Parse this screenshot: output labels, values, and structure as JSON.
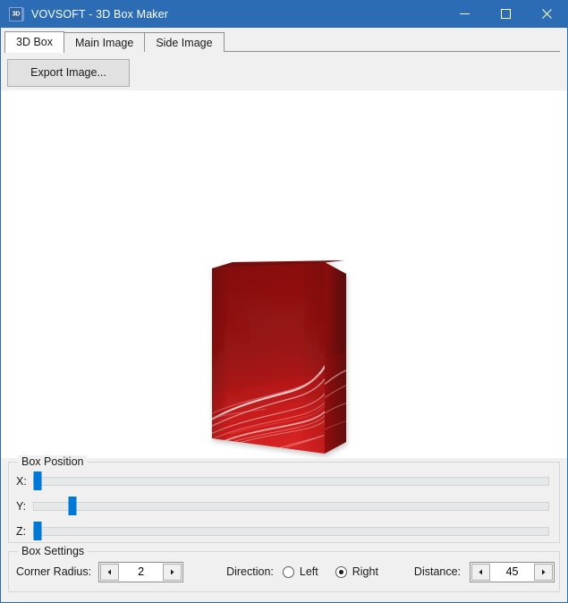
{
  "window": {
    "title": "VOVSOFT - 3D Box Maker",
    "icon_label": "3D",
    "icon_name": "app-icon-3d-box",
    "accent_color": "#2b6cb5",
    "controls": {
      "minimize": "minimize-icon",
      "maximize": "maximize-icon",
      "close": "close-icon"
    }
  },
  "tabs": [
    {
      "label": "3D Box",
      "active": true
    },
    {
      "label": "Main Image",
      "active": false
    },
    {
      "label": "Side Image",
      "active": false
    }
  ],
  "toolbar": {
    "export_label": "Export Image..."
  },
  "preview": {
    "description": "3D software box render",
    "front_color_top": "#8d1111",
    "front_color_bottom": "#d42020",
    "side_color": "#6d0f0f",
    "top_color": "#7c1010",
    "accent_swirl_color": "#ffffff"
  },
  "box_position": {
    "title": "Box Position",
    "sliders": [
      {
        "label": "X:",
        "value": 0,
        "min": 0,
        "max": 100,
        "percent": 0
      },
      {
        "label": "Y:",
        "value": 7,
        "min": 0,
        "max": 100,
        "percent": 7
      },
      {
        "label": "Z:",
        "value": 0,
        "min": 0,
        "max": 100,
        "percent": 0
      }
    ]
  },
  "box_settings": {
    "title": "Box Settings",
    "corner_radius": {
      "label": "Corner Radius:",
      "value": "2",
      "decrement_icon": "left-arrow-icon",
      "increment_icon": "right-arrow-icon"
    },
    "direction": {
      "label": "Direction:",
      "options": [
        {
          "label": "Left",
          "checked": false
        },
        {
          "label": "Right",
          "checked": true
        }
      ]
    },
    "distance": {
      "label": "Distance:",
      "value": "45",
      "decrement_icon": "left-arrow-icon",
      "increment_icon": "right-arrow-icon"
    }
  }
}
